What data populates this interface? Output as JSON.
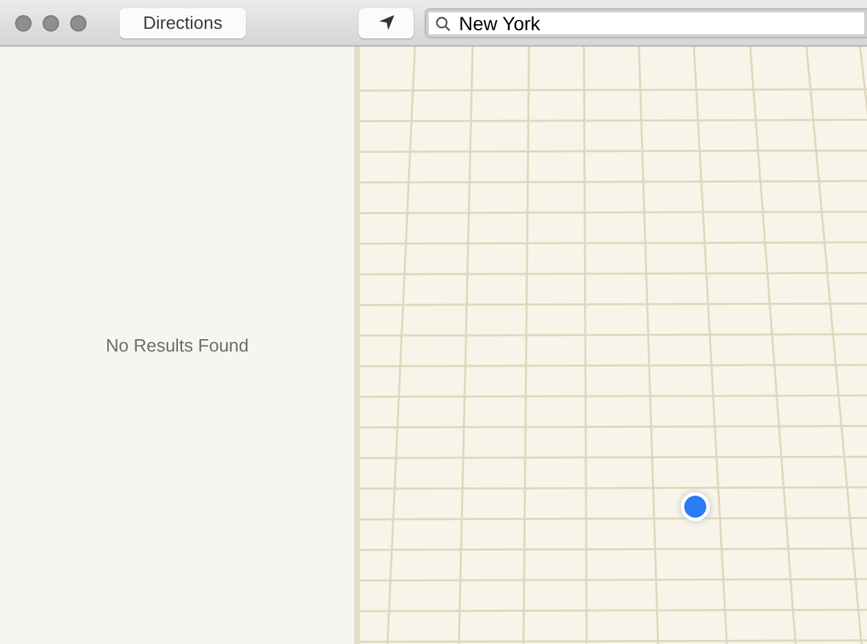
{
  "toolbar": {
    "directions_button": "Directions",
    "search": {
      "value": "New York"
    }
  },
  "sidebar": {
    "message": "No Results Found"
  }
}
